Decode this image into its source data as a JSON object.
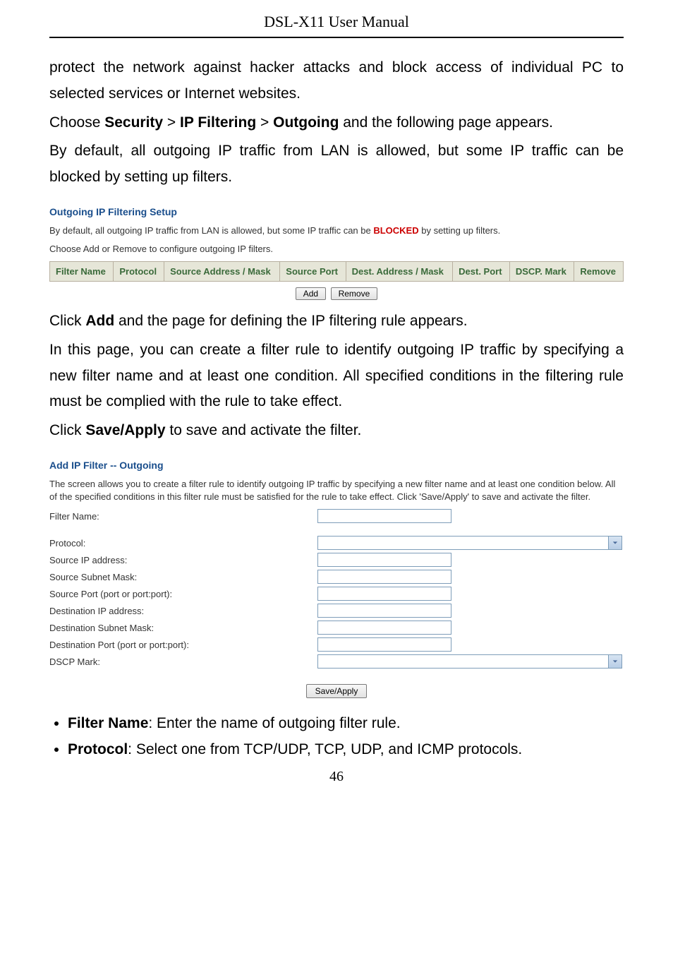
{
  "header": "DSL-X11 User Manual",
  "para1": "protect the network against hacker attacks and block access of individual PC to selected services or Internet websites.",
  "para2_pre": "Choose ",
  "para2_b1": "Security",
  "para2_sep1": " > ",
  "para2_b2": "IP Filtering",
  "para2_sep2": " > ",
  "para2_b3": "Outgoing",
  "para2_post": " and the following page appears.",
  "para3": "By default, all outgoing IP traffic from LAN is allowed, but some IP traffic can be blocked by setting up filters.",
  "sec1_title": "Outgoing IP Filtering Setup",
  "sec1_line1_pre": "By default, all outgoing IP traffic from LAN is allowed, but some IP traffic can be ",
  "sec1_line1_blocked": "BLOCKED",
  "sec1_line1_post": " by setting up filters.",
  "sec1_line2": "Choose Add or Remove to configure outgoing IP filters.",
  "table_headers": {
    "c1": "Filter Name",
    "c2": "Protocol",
    "c3": "Source Address / Mask",
    "c4": "Source Port",
    "c5": "Dest. Address / Mask",
    "c6": "Dest. Port",
    "c7": "DSCP. Mark",
    "c8": "Remove"
  },
  "btn_add": "Add",
  "btn_remove": "Remove",
  "para4_pre": "Click ",
  "para4_b": "Add",
  "para4_post": " and the page for defining the IP filtering rule appears.",
  "para5": "In this page, you can create a filter rule to identify outgoing IP traffic by specifying a new filter name and at least one condition. All specified conditions in the filtering rule must be complied with the rule to take effect.",
  "para6_pre": "Click ",
  "para6_b": "Save/Apply",
  "para6_post": " to save and activate the filter.",
  "sec2_title": "Add IP Filter -- Outgoing",
  "sec2_desc": "The screen allows you to create a filter rule to identify outgoing IP traffic by specifying a new filter name and at least one condition below. All of the specified conditions in this filter rule must be satisfied for the rule to take effect. Click 'Save/Apply' to save and activate the filter.",
  "form": {
    "filter_name": "Filter Name:",
    "protocol": "Protocol:",
    "src_ip": "Source IP address:",
    "src_mask": "Source Subnet Mask:",
    "src_port": "Source Port (port or port:port):",
    "dst_ip": "Destination IP address:",
    "dst_mask": "Destination Subnet Mask:",
    "dst_port": "Destination Port (port or port:port):",
    "dscp": "DSCP Mark:"
  },
  "btn_save": "Save/Apply",
  "bullets": {
    "b1_label": "Filter Name",
    "b1_text": ": Enter the name of outgoing filter rule.",
    "b2_label": "Protocol",
    "b2_text": ": Select one from TCP/UDP, TCP, UDP, and ICMP protocols."
  },
  "page_number": "46"
}
